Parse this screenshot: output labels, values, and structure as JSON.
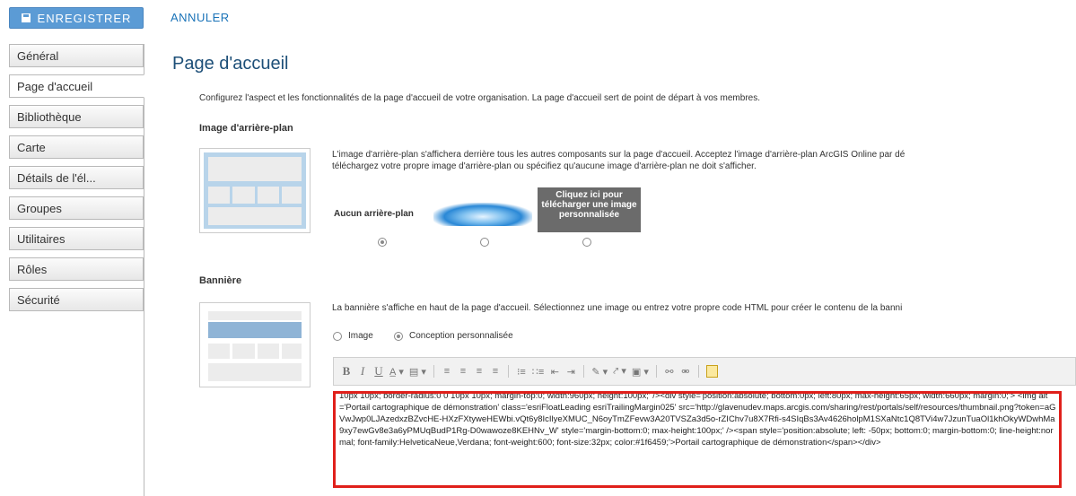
{
  "toolbar": {
    "save_label": "ENREGISTRER",
    "cancel_label": "ANNULER"
  },
  "sidebar": {
    "items": [
      {
        "label": "Général"
      },
      {
        "label": "Page d'accueil"
      },
      {
        "label": "Bibliothèque"
      },
      {
        "label": "Carte"
      },
      {
        "label": "Détails de l'él..."
      },
      {
        "label": "Groupes"
      },
      {
        "label": "Utilitaires"
      },
      {
        "label": "Rôles"
      },
      {
        "label": "Sécurité"
      }
    ],
    "active_index": 1
  },
  "main": {
    "title": "Page d'accueil",
    "intro": "Configurez l'aspect et les fonctionnalités de la page d'accueil de votre organisation. La page d'accueil sert de point de départ à vos membres.",
    "background": {
      "heading": "Image d'arrière-plan",
      "description": "L'image d'arrière-plan s'affichera derrière tous les autres composants sur la page d'accueil. Acceptez l'image d'arrière-plan ArcGIS Online par dé\ntéléchargez votre propre image d'arrière-plan ou spécifiez qu'aucune image d'arrière-plan ne doit s'afficher.",
      "no_background_label": "Aucun arrière-plan",
      "upload_label": "Cliquez ici pour télécharger une image personnalisée",
      "selected_option": 0
    },
    "banner": {
      "heading": "Bannière",
      "description": "La bannière s'affiche en haut de la page d'accueil. Sélectionnez une image ou entrez votre propre code HTML pour créer le contenu de la banni",
      "option_image": "Image",
      "option_custom": "Conception personnalisée",
      "selected_option": "custom",
      "editor_code": "10px 10px; border-radius:0 0 10px 10px; margin-top:0; width:960px; height:100px;' /><div style='position:absolute; bottom:0px; left:80px; max-height:65px; width:660px; margin:0;'> <img alt='Portail cartographique de démonstration' class='esriFloatLeading esriTrailingMargin025' src='http://glavenudev.maps.arcgis.com/sharing/rest/portals/self/resources/thumbnail.png?token=aGVwJwp0LJAzedxzBZvcHE-HXzFXtyweHEWbi.vQt6y8IcIlyeXMUC_N6oyTmZFevw3A20TVSZa3d5o-rZIChv7u8X7Rfi-s4SIqBs3Av4626holpM1SXaNtc1Q8TVi4w7JzunTuaOl1khOkyWDwhMa9xy7ewGv8e3a6yPMUqBudP1Rg-D0wawoze8KEHNv_W' style='margin-bottom:0; max-height:100px;' /><span style='position:absolute; left: -50px; bottom:0; margin-bottom:0; line-height:normal; font-family:HelveticaNeue,Verdana; font-weight:600; font-size:32px; color:#1f6459;'>Portail cartographique de démonstration</span></div>"
    }
  },
  "colors": {
    "primary_button": "#5b9bd5",
    "link": "#1a73b8",
    "title": "#1d4f78",
    "highlight_border": "#e0201b"
  }
}
